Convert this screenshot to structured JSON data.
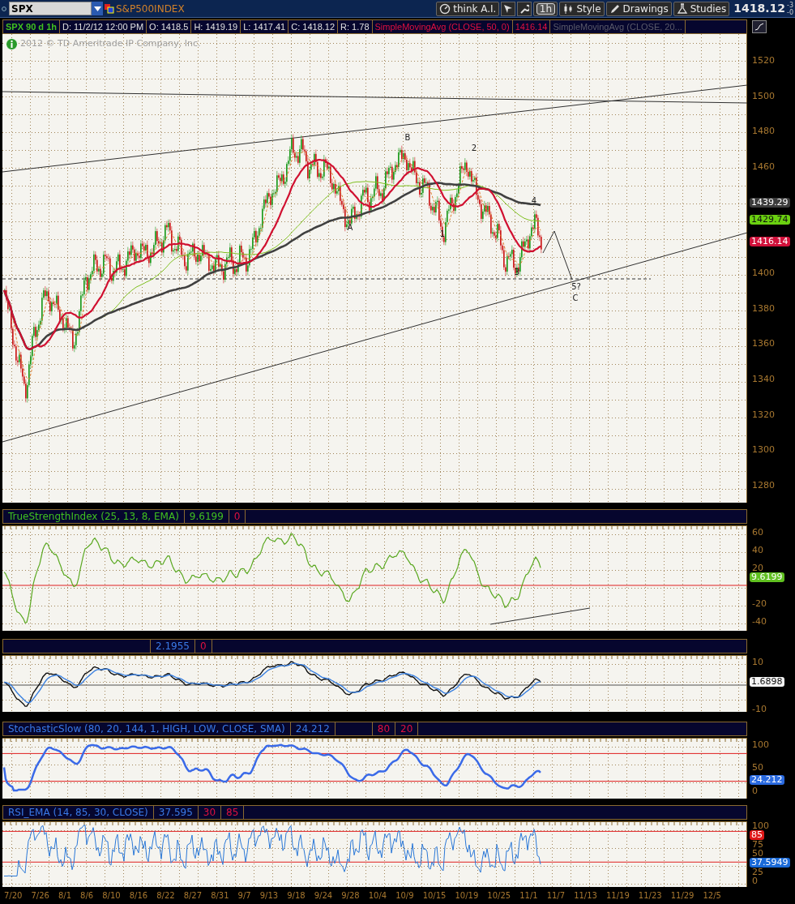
{
  "toolbar": {
    "symbol": "SPX",
    "description": "S&P500INDEX",
    "buttons": [
      {
        "label": "think A.I."
      },
      {
        "label": "1h"
      },
      {
        "label": "Style"
      },
      {
        "label": "Drawings"
      },
      {
        "label": "Studies"
      }
    ],
    "last_price": "1418.12",
    "change_fragments": [
      "-3",
      "-0"
    ]
  },
  "info_bar": {
    "cells": [
      {
        "text": "SPX 90 d 1h",
        "kind": "symbol"
      },
      {
        "text": "D: 11/2/12 12:00 PM",
        "kind": "field"
      },
      {
        "text": "O: 1418.5",
        "kind": "field"
      },
      {
        "text": "H: 1419.19",
        "kind": "field"
      },
      {
        "text": "L: 1417.41",
        "kind": "field"
      },
      {
        "text": "C: 1418.12",
        "kind": "field"
      },
      {
        "text": "R: 1.78",
        "kind": "field"
      },
      {
        "text": "SimpleMovingAvg (CLOSE, 50, 0)",
        "kind": "study"
      },
      {
        "text": "1416.14",
        "kind": "study"
      },
      {
        "text": "SimpleMovingAvg (CLOSE, 20...",
        "kind": "hidden_study"
      }
    ]
  },
  "copyright": "2012 © TD Ameritrade IP Company, Inc.",
  "price_axis": [
    {
      "kind": "tick",
      "label": "1520"
    },
    {
      "kind": "tick",
      "label": "1500"
    },
    {
      "kind": "tick",
      "label": "1480"
    },
    {
      "kind": "tick",
      "label": "1460"
    },
    {
      "kind": "badge",
      "label": "1439.29",
      "color": "#3c3c3c"
    },
    {
      "kind": "badge",
      "label": "1429.74",
      "color": "#6ad010"
    },
    {
      "kind": "badge",
      "label": "1416.14",
      "color": "#d0103a"
    },
    {
      "kind": "tick",
      "label": "1400"
    },
    {
      "kind": "tick",
      "label": "1380"
    },
    {
      "kind": "tick",
      "label": "1360"
    },
    {
      "kind": "tick",
      "label": "1340"
    },
    {
      "kind": "tick",
      "label": "1320"
    },
    {
      "kind": "tick",
      "label": "1300"
    },
    {
      "kind": "tick",
      "label": "1280"
    }
  ],
  "wave_labels": [
    "A",
    "B",
    "1",
    "2",
    "3",
    "4",
    "5?",
    "C"
  ],
  "indicators": [
    {
      "kind": "tsi",
      "legend": [
        {
          "text": "TrueStrengthIndex (25, 13, 8, EMA)",
          "kind": "study"
        },
        {
          "text": "9.6199",
          "kind": "study"
        },
        {
          "text": "0",
          "kind": "level"
        }
      ],
      "axis": [
        {
          "kind": "tick",
          "label": "60"
        },
        {
          "kind": "tick",
          "label": "40"
        },
        {
          "kind": "tick",
          "label": "20"
        },
        {
          "kind": "badge",
          "label": "9.6199",
          "color": "#60c020"
        },
        {
          "kind": "tick",
          "label": "-20"
        },
        {
          "kind": "tick",
          "label": "-40"
        }
      ]
    },
    {
      "kind": "macd",
      "legend": [
        {
          "text": "2.1955",
          "kind": "study"
        },
        {
          "text": "0",
          "kind": "level"
        }
      ],
      "axis": [
        {
          "kind": "tick",
          "label": "10"
        },
        {
          "kind": "badge",
          "label": "1.6898",
          "color": "#f4f4f4"
        },
        {
          "kind": "tick",
          "label": "-10"
        }
      ]
    },
    {
      "kind": "stochastic",
      "legend": [
        {
          "text": "StochasticSlow (80, 20, 144, 1, HIGH, LOW, CLOSE, SMA)",
          "kind": "study"
        },
        {
          "text": "24.212",
          "kind": "study"
        },
        {
          "text": "80",
          "kind": "level"
        },
        {
          "text": "20",
          "kind": "level"
        }
      ],
      "axis": [
        {
          "kind": "tick",
          "label": "100"
        },
        {
          "kind": "tick",
          "label": "50"
        },
        {
          "kind": "badge",
          "label": "24.212",
          "color": "#2a6ae0"
        },
        {
          "kind": "tick",
          "label": "0"
        }
      ]
    },
    {
      "kind": "rsi",
      "legend": [
        {
          "text": "RSI_EMA (14, 85, 30, CLOSE)",
          "kind": "study"
        },
        {
          "text": "37.595",
          "kind": "study"
        },
        {
          "text": "30",
          "kind": "level"
        },
        {
          "text": "85",
          "kind": "level"
        }
      ],
      "axis": [
        {
          "kind": "tick",
          "label": "100"
        },
        {
          "kind": "badge",
          "label": "85",
          "color": "#e01818"
        },
        {
          "kind": "tick",
          "label": "75"
        },
        {
          "kind": "tick",
          "label": "50"
        },
        {
          "kind": "badge",
          "label": "37.5949",
          "color": "#1a6ad8"
        },
        {
          "kind": "tick",
          "label": "25"
        },
        {
          "kind": "tick",
          "label": "0"
        }
      ]
    }
  ],
  "dates": [
    "7/20",
    "7/26",
    "8/1",
    "8/6",
    "8/10",
    "8/16",
    "8/22",
    "8/27",
    "8/31",
    "9/7",
    "9/13",
    "9/18",
    "9/24",
    "9/28",
    "10/4",
    "10/9",
    "10/15",
    "10/19",
    "10/25",
    "11/1",
    "11/7",
    "11/13",
    "11/19",
    "11/23",
    "11/29",
    "12/5"
  ]
}
